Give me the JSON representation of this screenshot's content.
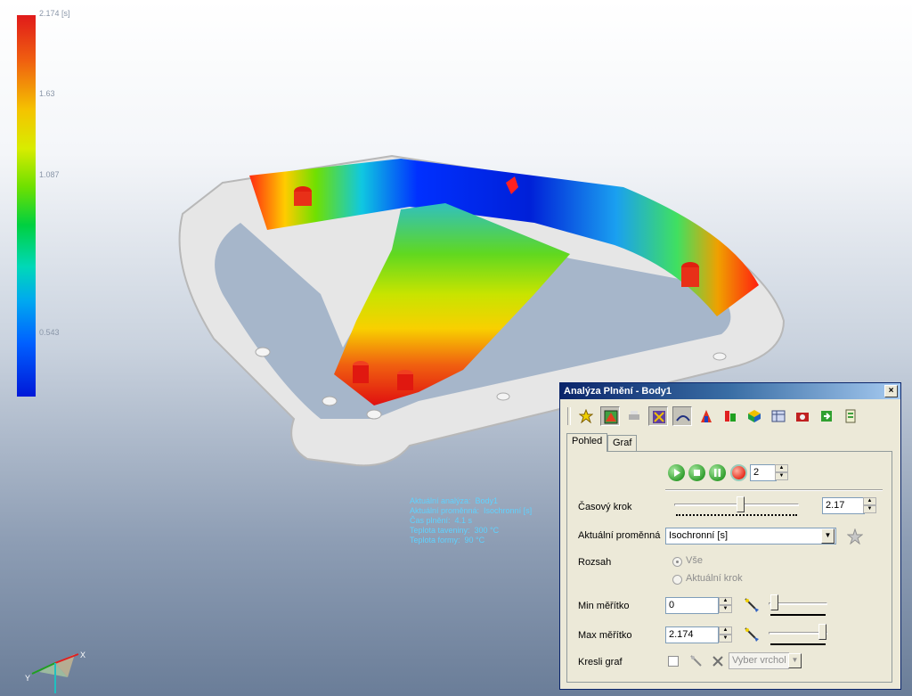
{
  "legend": {
    "max_label": "2.174 [s]",
    "tick_labels": [
      "1.63",
      "1.087",
      "0.543"
    ],
    "colors": [
      "#e01a1a",
      "#f4c400",
      "#6ee000",
      "#00d8b8",
      "#0060ff",
      "#0018d8"
    ]
  },
  "result_info": {
    "lines": [
      "Aktuální analýza:  Body1",
      "Aktuální proměnná:  Isochronní [s]",
      "Čas plnění:  4.1 s",
      "Teplota taveniny:  300 °C",
      "Teplota formy:  90 °C"
    ]
  },
  "triad": {
    "x_label": "X",
    "y_label": "Y"
  },
  "dialog": {
    "title": "Analýza Plnění - Body1",
    "close_label": "×",
    "toolbar_icons": [
      "star-icon",
      "result-view-icon",
      "printer-icon",
      "compare-icon",
      "pressure-icon",
      "warpage-icon",
      "info-icon",
      "mesh-icon",
      "table-icon",
      "camera-icon",
      "export-icon",
      "report-icon"
    ],
    "tabs": [
      "Pohled",
      "Graf"
    ],
    "active_tab": "Pohled",
    "frame_value": "2",
    "time_step": {
      "label": "Časový krok",
      "value": "2.17"
    },
    "variable": {
      "label": "Aktuální proměnná",
      "value": "Isochronní [s]"
    },
    "range": {
      "label": "Rozsah",
      "option_all": "Vše",
      "option_current": "Aktuální krok",
      "selected": "Vše"
    },
    "min_scale": {
      "label": "Min měřítko",
      "value": "0"
    },
    "max_scale": {
      "label": "Max měřítko",
      "value": "2.174"
    },
    "draw_graph": {
      "label": "Kresli graf",
      "vertex_placeholder": "Vyber vrchol"
    }
  }
}
